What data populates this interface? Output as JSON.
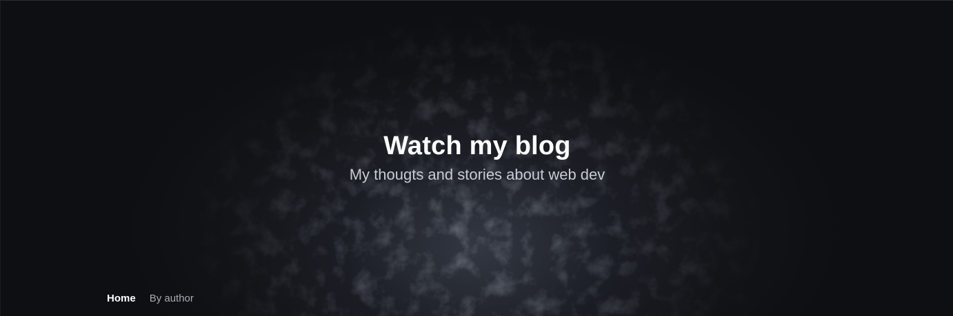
{
  "hero": {
    "title": "Watch my blog",
    "subtitle": "My thougts and stories about web dev"
  },
  "nav": {
    "items": [
      {
        "label": "Home",
        "active": true
      },
      {
        "label": "By author",
        "active": false
      }
    ]
  },
  "colors": {
    "background": "#0e0f12",
    "title": "#ffffff",
    "subtitle": "#c9ccd2",
    "nav_inactive": "#a7abb3"
  }
}
